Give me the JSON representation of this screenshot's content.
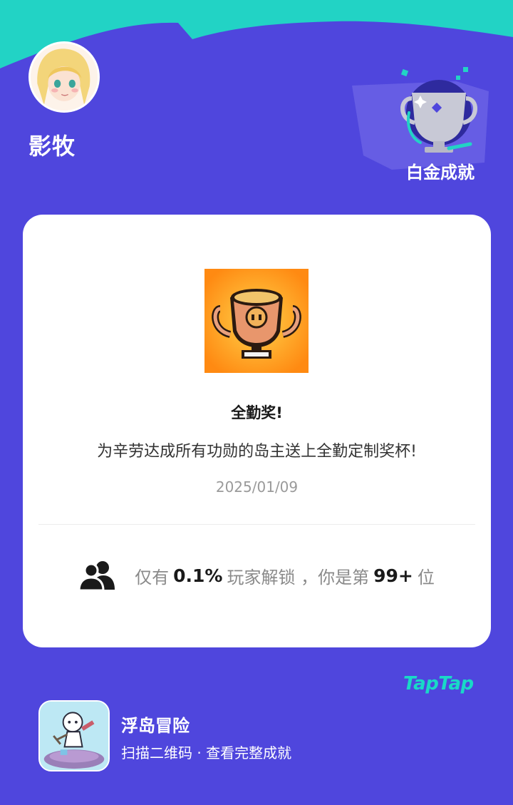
{
  "profile": {
    "username": "影牧"
  },
  "badge": {
    "label": "白金成就",
    "icon": "trophy-icon"
  },
  "achievement": {
    "icon": "pixel-trophy-icon",
    "title": "全勤奖!",
    "description": "为辛劳达成所有功勋的岛主送上全勤定制奖杯!",
    "date": "2025/01/09"
  },
  "rarity": {
    "prefix": "仅有",
    "percent": "0.1%",
    "middle": "玩家解锁 ，你是第",
    "rank": "99+",
    "suffix": "位"
  },
  "brand": {
    "name": "TapTap"
  },
  "game": {
    "name": "浮岛冒险",
    "cta": "扫描二维码 · 查看完整成就"
  },
  "colors": {
    "background": "#4f46dd",
    "accent": "#19d9c7",
    "card": "#ffffff"
  }
}
